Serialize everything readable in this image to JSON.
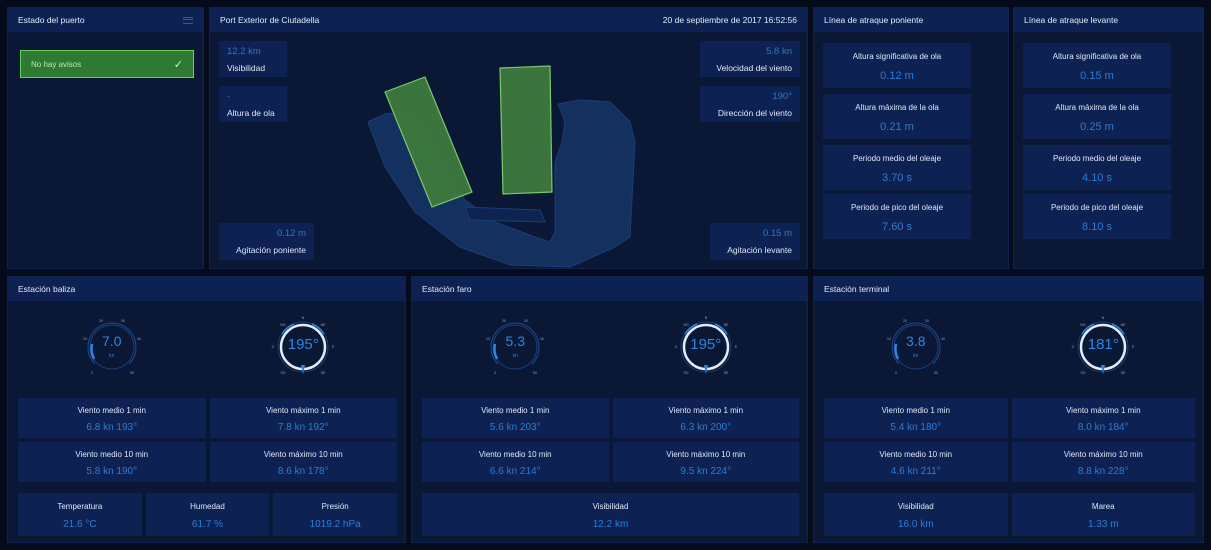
{
  "estado": {
    "title": "Estado del puerto",
    "alert": "No hay avisos"
  },
  "port": {
    "title": "Port Exterior de Ciutadella",
    "datetime": "20 de septiembre de 2017 16:52:56",
    "visibilidad": {
      "value": "12.2 km",
      "label": "Visibilidad"
    },
    "altura_ola": {
      "value": "-",
      "label": "Altura de ola"
    },
    "vel_viento": {
      "value": "5.8 kn",
      "label": "Velocidad del viento"
    },
    "dir_viento": {
      "value": "190°",
      "label": "Dirección del viento"
    },
    "agit_poniente": {
      "value": "0.12 m",
      "label": "Agitación poniente"
    },
    "agit_levante": {
      "value": "0.15 m",
      "label": "Agitación levante"
    }
  },
  "poniente": {
    "title": "Línea de atraque poniente",
    "items": [
      {
        "label": "Altura significativa de ola",
        "value": "0.12 m"
      },
      {
        "label": "Altura máxima de la ola",
        "value": "0.21 m"
      },
      {
        "label": "Periodo medio del oleaje",
        "value": "3.70 s"
      },
      {
        "label": "Periodo de pico del oleaje",
        "value": "7.60 s"
      }
    ]
  },
  "levante": {
    "title": "Línea de atraque levante",
    "items": [
      {
        "label": "Altura significativa de ola",
        "value": "0.15 m"
      },
      {
        "label": "Altura máxima de la ola",
        "value": "0.25 m"
      },
      {
        "label": "Periodo medio del oleaje",
        "value": "4.10 s"
      },
      {
        "label": "Periodo de pico del oleaje",
        "value": "8.10 s"
      }
    ]
  },
  "baliza": {
    "title": "Estación baliza",
    "speed": {
      "value": "7.0",
      "unit": "kn",
      "ticks": [
        "20",
        "30",
        "10",
        "40",
        "0",
        "50"
      ]
    },
    "direction": {
      "value": "195°",
      "ticks": [
        "N",
        "NO",
        "NE",
        "O",
        "E",
        "SO",
        "SE"
      ]
    },
    "items": [
      {
        "label": "Viento medio 1 min",
        "value": "6.8 kn 193°"
      },
      {
        "label": "Viento máximo 1 min",
        "value": "7.8 kn 192°"
      },
      {
        "label": "Viento medio 10 min",
        "value": "5.8 kn 190°"
      },
      {
        "label": "Viento máximo 10 min",
        "value": "8.6 kn 178°"
      }
    ],
    "bottom": [
      {
        "label": "Temperatura",
        "value": "21.6 °C"
      },
      {
        "label": "Humedad",
        "value": "61.7 %"
      },
      {
        "label": "Presión",
        "value": "1019.2 hPa"
      }
    ]
  },
  "faro": {
    "title": "Estación faro",
    "speed": {
      "value": "5.3",
      "unit": "kn",
      "ticks": [
        "20",
        "30",
        "10",
        "40",
        "0",
        "50"
      ]
    },
    "direction": {
      "value": "195°",
      "ticks": [
        "N",
        "NO",
        "NE",
        "O",
        "E",
        "SO",
        "SE"
      ]
    },
    "items": [
      {
        "label": "Viento medio 1 min",
        "value": "5.6 kn 203°"
      },
      {
        "label": "Viento máximo 1 min",
        "value": "6.3 kn 200°"
      },
      {
        "label": "Viento medio 10 min",
        "value": "6.6 kn 214°"
      },
      {
        "label": "Viento máximo 10 min",
        "value": "9.5 kn 224°"
      }
    ],
    "bottom": [
      {
        "label": "Visibilidad",
        "value": "12.2 km"
      }
    ]
  },
  "terminal": {
    "title": "Estación terminal",
    "speed": {
      "value": "3.8",
      "unit": "kn",
      "ticks": [
        "20",
        "30",
        "10",
        "40",
        "0",
        "50"
      ]
    },
    "direction": {
      "value": "181°",
      "ticks": [
        "N",
        "NO",
        "NE",
        "O",
        "E",
        "SO",
        "SE"
      ]
    },
    "items": [
      {
        "label": "Viento medio 1 min",
        "value": "5.4 kn 180°"
      },
      {
        "label": "Viento máximo 1 min",
        "value": "8.0 kn 184°"
      },
      {
        "label": "Viento medio 10 min",
        "value": "4.6 kn 211°"
      },
      {
        "label": "Viento máximo 10 min",
        "value": "8.8 kn 228°"
      }
    ],
    "bottom": [
      {
        "label": "Visibilidad",
        "value": "16.0 km"
      },
      {
        "label": "Marea",
        "value": "1.33 m"
      }
    ]
  },
  "colors": {
    "accent": "#2f86e0",
    "ok": "#2f7a33",
    "panel": "#0a1735"
  }
}
